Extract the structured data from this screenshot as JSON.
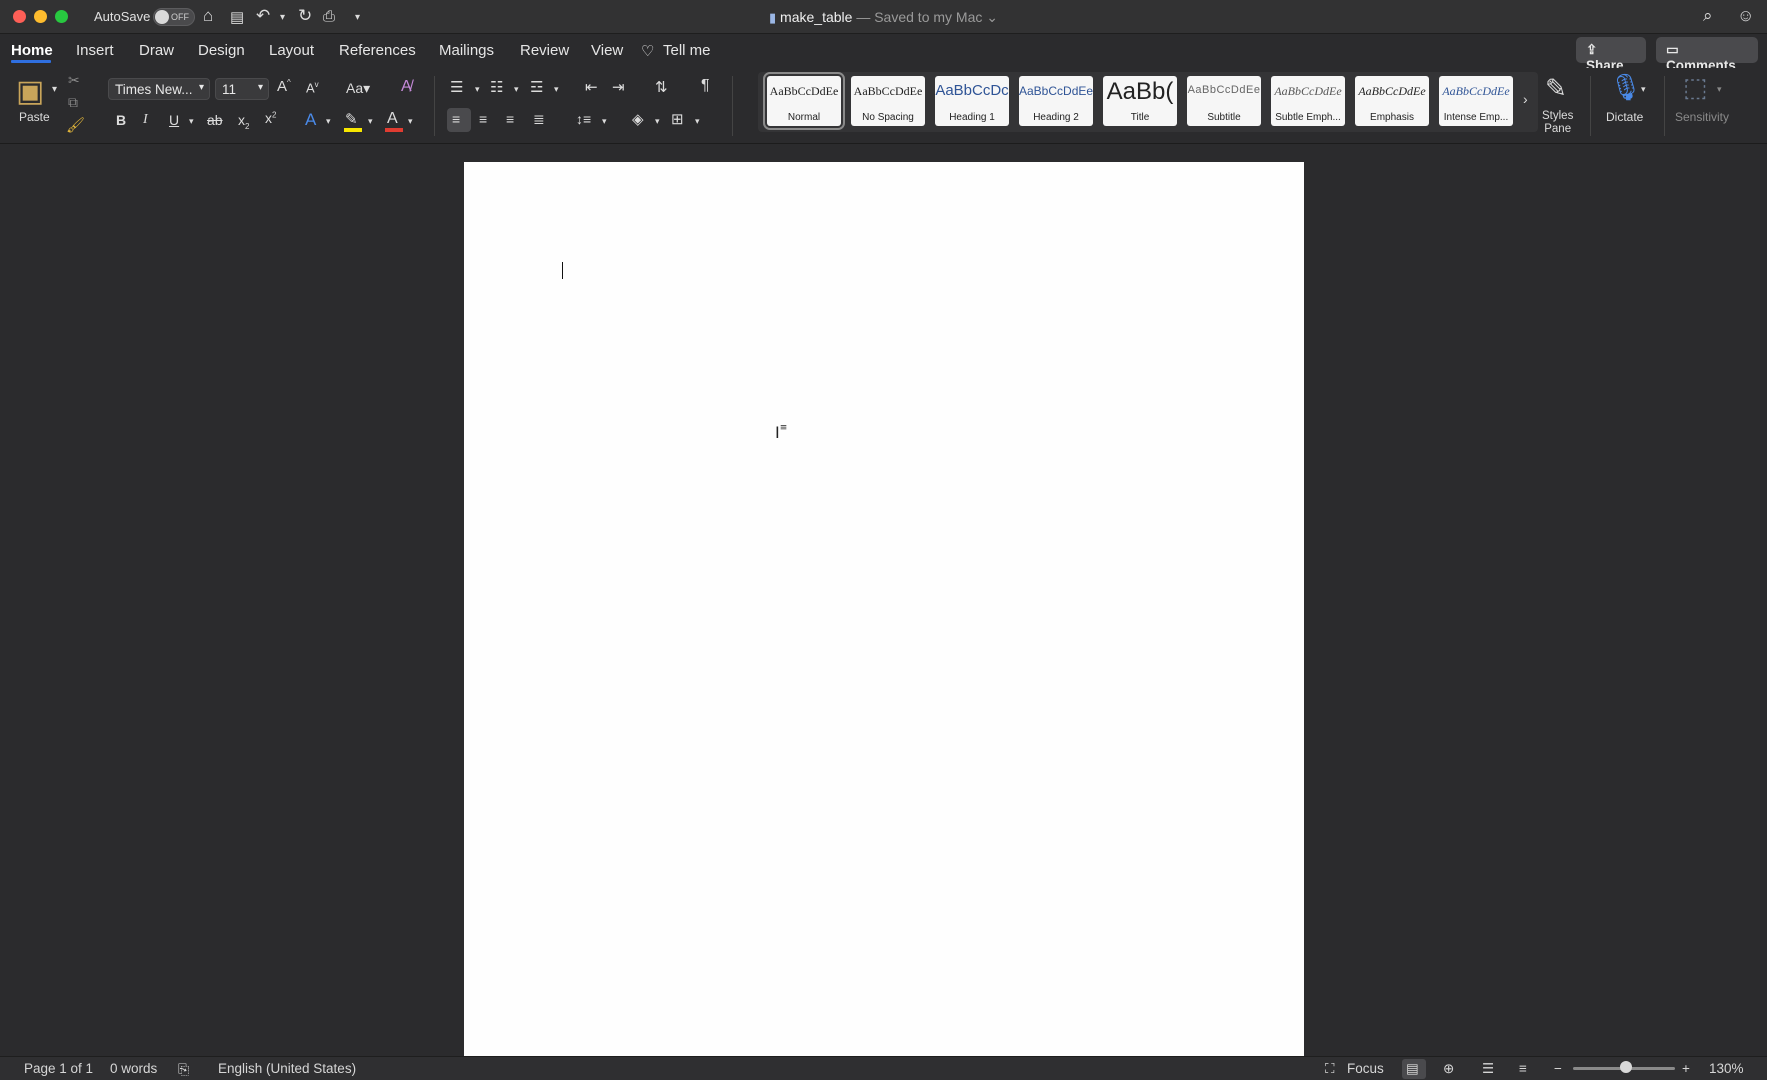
{
  "window": {
    "autosave_label": "AutoSave",
    "autosave_state": "OFF",
    "doc_name": "make_table",
    "doc_status": " — Saved to my Mac",
    "status_chevron": "⌄"
  },
  "tabs": [
    "Home",
    "Insert",
    "Draw",
    "Design",
    "Layout",
    "References",
    "Mailings",
    "Review",
    "View",
    "Tell me"
  ],
  "header_buttons": {
    "share": "Share",
    "comments": "Comments"
  },
  "ribbon": {
    "paste_label": "Paste",
    "font_name": "Times New...",
    "font_size": "11",
    "styles_pane_label": "Styles\nPane",
    "dictate_label": "Dictate",
    "sensitivity_label": "Sensitivity"
  },
  "styles": [
    {
      "sample": "AaBbCcDdEe",
      "label": "Normal"
    },
    {
      "sample": "AaBbCcDdEe",
      "label": "No Spacing"
    },
    {
      "sample": "AaBbCcDc",
      "label": "Heading 1"
    },
    {
      "sample": "AaBbCcDdEe",
      "label": "Heading 2"
    },
    {
      "sample": "AaBb(",
      "label": "Title"
    },
    {
      "sample": "AaBbCcDdEe",
      "label": "Subtitle"
    },
    {
      "sample": "AaBbCcDdEe",
      "label": "Subtle Emph..."
    },
    {
      "sample": "AaBbCcDdEe",
      "label": "Emphasis"
    },
    {
      "sample": "AaBbCcDdEe",
      "label": "Intense Emp..."
    }
  ],
  "status": {
    "page": "Page 1 of 1",
    "words": "0 words",
    "language": "English (United States)",
    "focus": "Focus",
    "zoom": "130%"
  },
  "colors": {
    "accent": "#2f6fe0",
    "highlight": "#f7e600",
    "font_color": "#e03c31"
  }
}
